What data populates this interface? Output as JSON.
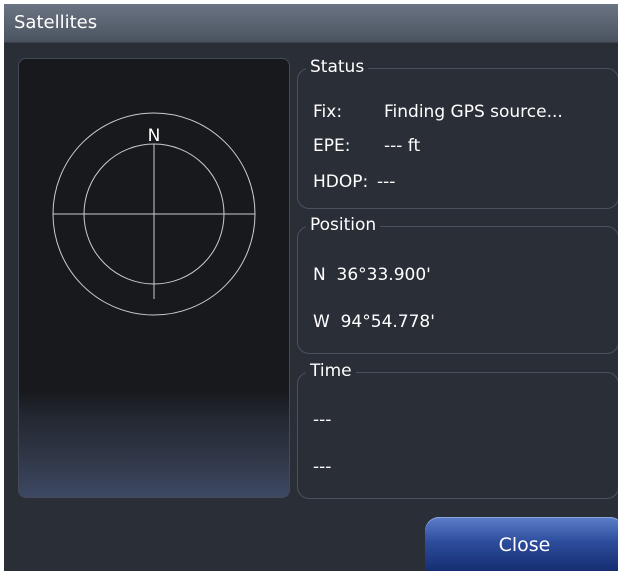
{
  "window": {
    "title": "Satellites"
  },
  "sky_view": {
    "north_label": "N"
  },
  "status": {
    "title": "Status",
    "fix_label": "Fix:",
    "fix_value": "Finding GPS source...",
    "epe_label": "EPE:",
    "epe_value": "--- ft",
    "hdop_label": "HDOP:",
    "hdop_value": "---"
  },
  "position": {
    "title": "Position",
    "latitude": "N  36°33.900'",
    "longitude": "W  94°54.778'"
  },
  "time": {
    "title": "Time",
    "line1": "---",
    "line2": "---"
  },
  "buttons": {
    "close_label": "Close"
  },
  "colors": {
    "dialog_bg": "#2a2e37",
    "titlebar": "#5b6472",
    "button_accent": "#2c4c9c"
  }
}
